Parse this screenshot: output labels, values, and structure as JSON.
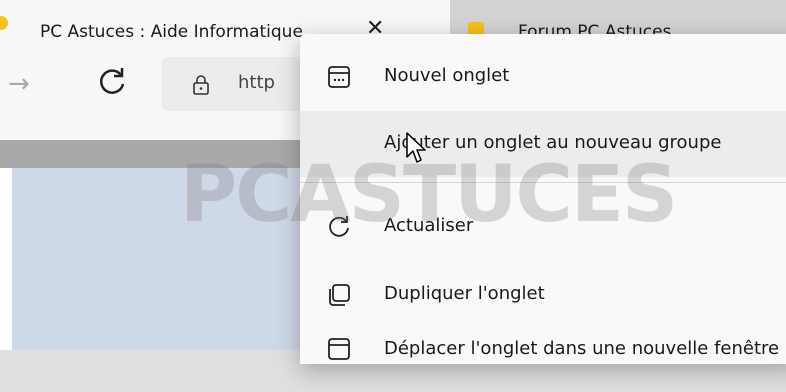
{
  "tabs": [
    {
      "title": "PC Astuces : Aide Informatique",
      "close": "✕"
    },
    {
      "title": "Forum PC Astuces"
    }
  ],
  "toolbar": {
    "url_partial": "http"
  },
  "watermark": "PCASTUCES",
  "context_menu": {
    "items": [
      {
        "label": "Nouvel onglet",
        "icon": "new-tab-icon"
      },
      {
        "label": "Ajouter un onglet au nouveau groupe",
        "icon": "none"
      },
      {
        "label": "Actualiser",
        "icon": "refresh-icon"
      },
      {
        "label": "Dupliquer l'onglet",
        "icon": "duplicate-icon"
      },
      {
        "label": "Déplacer l'onglet dans une nouvelle fenêtre",
        "icon": "window-icon"
      }
    ]
  }
}
